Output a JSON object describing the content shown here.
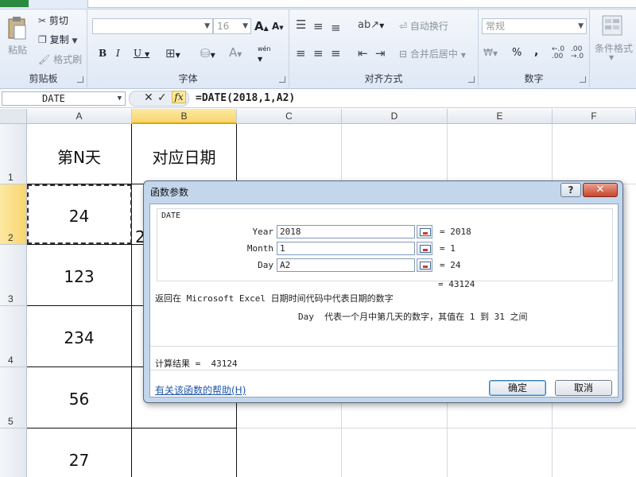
{
  "ribbon": {
    "clipboard": {
      "paste": "粘贴",
      "cut": "剪切",
      "copy": "复制",
      "format_painter": "格式刷",
      "label": "剪贴板"
    },
    "font": {
      "name": "",
      "size": "16",
      "bold": "B",
      "italic": "I",
      "underline": "U",
      "grow": "A",
      "shrink": "A",
      "color_a": "A",
      "wen": "wén",
      "label": "字体"
    },
    "alignment": {
      "wrap": "自动换行",
      "merge": "合并后居中",
      "label": "对齐方式"
    },
    "number": {
      "format": "常规",
      "percent": "%",
      "comma": ",",
      "label": "数字"
    },
    "styles": {
      "cond_format": "条件格式"
    }
  },
  "formula_bar": {
    "name_box": "DATE",
    "cancel": "✕",
    "enter": "✓",
    "fx": "fx",
    "formula": "=DATE(2018,1,A2)"
  },
  "columns": [
    "A",
    "B",
    "C",
    "D",
    "E",
    "F"
  ],
  "rows": [
    "1",
    "2",
    "3",
    "4",
    "5"
  ],
  "cells": {
    "a1": "第N天",
    "b1": "对应日期",
    "a2": "24",
    "b2_partial": "2",
    "a3": "123",
    "a4": "234",
    "a5": "56",
    "a6": "27"
  },
  "dialog": {
    "title": "函数参数",
    "help": "?",
    "close": "✕",
    "function_name": "DATE",
    "args": [
      {
        "label": "Year",
        "value": "2018",
        "result": "= 2018"
      },
      {
        "label": "Month",
        "value": "1",
        "result": "= 1"
      },
      {
        "label": "Day",
        "value": "A2",
        "result": "= 24"
      }
    ],
    "total": "= 43124",
    "description": "返回在 Microsoft Excel 日期时间代码中代表日期的数字",
    "arg_description": "Day  代表一个月中第几天的数字，其值在 1 到 31 之间",
    "calc_result": "计算结果 =  43124",
    "help_link": "有关该函数的帮助(H)",
    "ok": "确定",
    "cancel": "取消"
  },
  "colors": {
    "selection": "#f8d46e",
    "close_red": "#c8462d",
    "dialog_frame": "#c3d6ec",
    "link": "#1f56a8"
  }
}
